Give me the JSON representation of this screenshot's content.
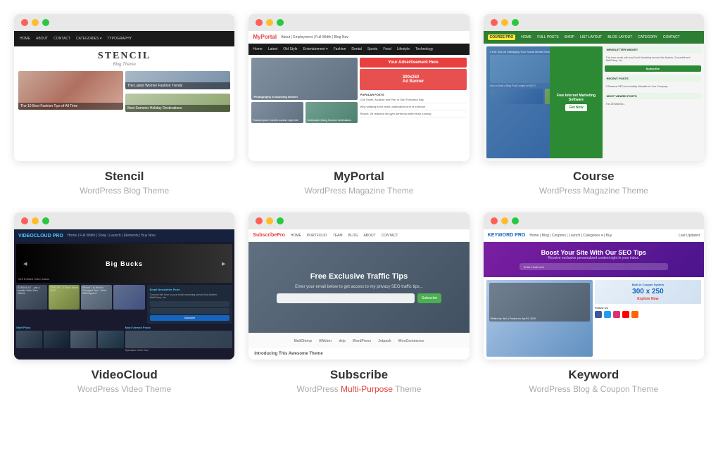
{
  "themes": [
    {
      "id": "stencil",
      "name": "Stencil",
      "subtitle": "WordPress Blog Theme",
      "subtitle_highlight": "",
      "logo": "STENCIL",
      "logo_sub": "Blog Theme",
      "caption1": "The 10 Best Fashion Tips of All Time",
      "caption2": "The Latest Women Fashion Trends",
      "caption3": "Best Summer Holiday Destinations"
    },
    {
      "id": "myportal",
      "name": "MyPortal",
      "subtitle": "WordPress Magazine Theme",
      "subtitle_highlight": "",
      "logo": "MyPortal"
    },
    {
      "id": "course",
      "name": "Course",
      "subtitle": "WordPress Magazine Theme",
      "subtitle_highlight": "",
      "logo": "COURSE PRO"
    },
    {
      "id": "videocloud",
      "name": "VideoCloud",
      "subtitle": "WordPress Video Theme",
      "subtitle_highlight": "",
      "logo": "VIDEOCLOUD PRO",
      "hero_text": "Big Bucks"
    },
    {
      "id": "subscribe",
      "name": "Subscribe",
      "subtitle_prefix": "WordPress ",
      "subtitle_middle": "Multi-Purpose",
      "subtitle_suffix": " Theme",
      "subtitle_highlight": "Multi-Purpose",
      "logo": "SubscribePro",
      "hero_title": "Free Exclusive Traffic Tips",
      "hero_sub": "Enter your email below to get access to my\nprivacy SEO traffic tips...",
      "logos": [
        "MailChimp",
        "AWeber",
        "drip",
        "WordPress",
        "Jetpack",
        "WooCommerce"
      ]
    },
    {
      "id": "keyword",
      "name": "Keyword",
      "subtitle": "WordPress Blog & Coupon Theme",
      "subtitle_highlight": "",
      "logo": "KEYWORD PRO",
      "hero_title": "Boost Your Site With Our SEO Tips",
      "hero_sub": "Receive exclusive personalized content right in your inbox.",
      "coupon_text": "Built-in Coupon System\n300 x 250\nExplore Now"
    }
  ],
  "browser": {
    "dot_red": "red",
    "dot_yellow": "yellow",
    "dot_green": "green"
  }
}
